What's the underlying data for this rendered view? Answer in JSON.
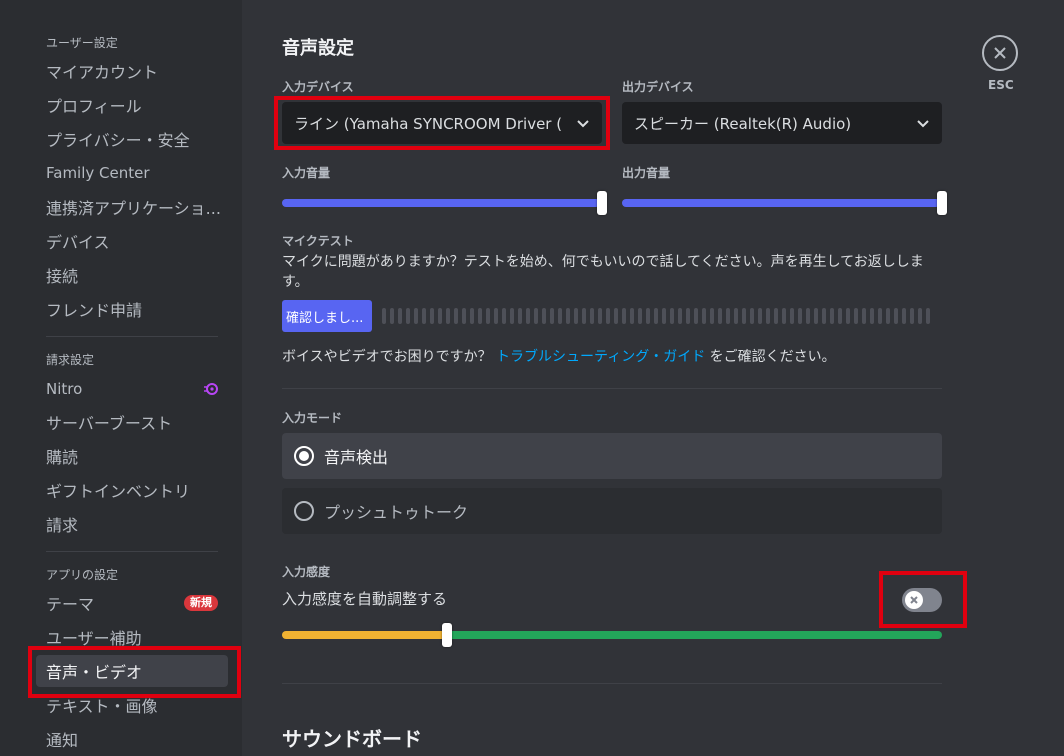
{
  "sidebar": {
    "user_header": "ユーザー設定",
    "user_items": [
      "マイアカウント",
      "プロフィール",
      "プライバシー・安全",
      "Family Center",
      "連携済アプリケーショ...",
      "デバイス",
      "接続",
      "フレンド申請"
    ],
    "billing_header": "請求設定",
    "billing_items": [
      "Nitro",
      "サーバーブースト",
      "購読",
      "ギフトインベントリ",
      "請求"
    ],
    "app_header": "アプリの設定",
    "app_items": [
      "テーマ",
      "ユーザー補助",
      "音声・ビデオ",
      "テキスト・画像",
      "通知"
    ],
    "new_badge": "新規"
  },
  "page": {
    "title": "音声設定",
    "esc_label": "ESC"
  },
  "input_device": {
    "label": "入力デバイス",
    "value": "ライン (Yamaha SYNCROOM Driver (WD"
  },
  "output_device": {
    "label": "出力デバイス",
    "value": "スピーカー (Realtek(R) Audio)"
  },
  "input_volume": {
    "label": "入力音量",
    "value": 1.0
  },
  "output_volume": {
    "label": "出力音量",
    "value": 1.0
  },
  "mic_test": {
    "label": "マイクテスト",
    "description_line1": "マイクに問題がありますか？テストを始め、何でもいいので話してください。声を再生してお返ししま",
    "description_line2": "す。",
    "button": "確認しまし..."
  },
  "help": {
    "prefix": "ボイスやビデオでお困りですか？",
    "link": "トラブルシューティング・ガイド",
    "suffix": "をご確認ください。"
  },
  "input_mode": {
    "label": "入力モード",
    "options": [
      "音声検出",
      "プッシュトゥトーク"
    ],
    "selected": "音声検出"
  },
  "sensitivity": {
    "label": "入力感度",
    "auto_label": "入力感度を自動調整する",
    "auto_enabled": false,
    "threshold": 0.25
  },
  "soundboard": {
    "title": "サウンドボード"
  },
  "colors": {
    "accent": "#5865f2",
    "highlight_box": "#e0000f",
    "sensitivity_low": "#f0b232",
    "sensitivity_high": "#23a55a",
    "link": "#00a8fc"
  }
}
